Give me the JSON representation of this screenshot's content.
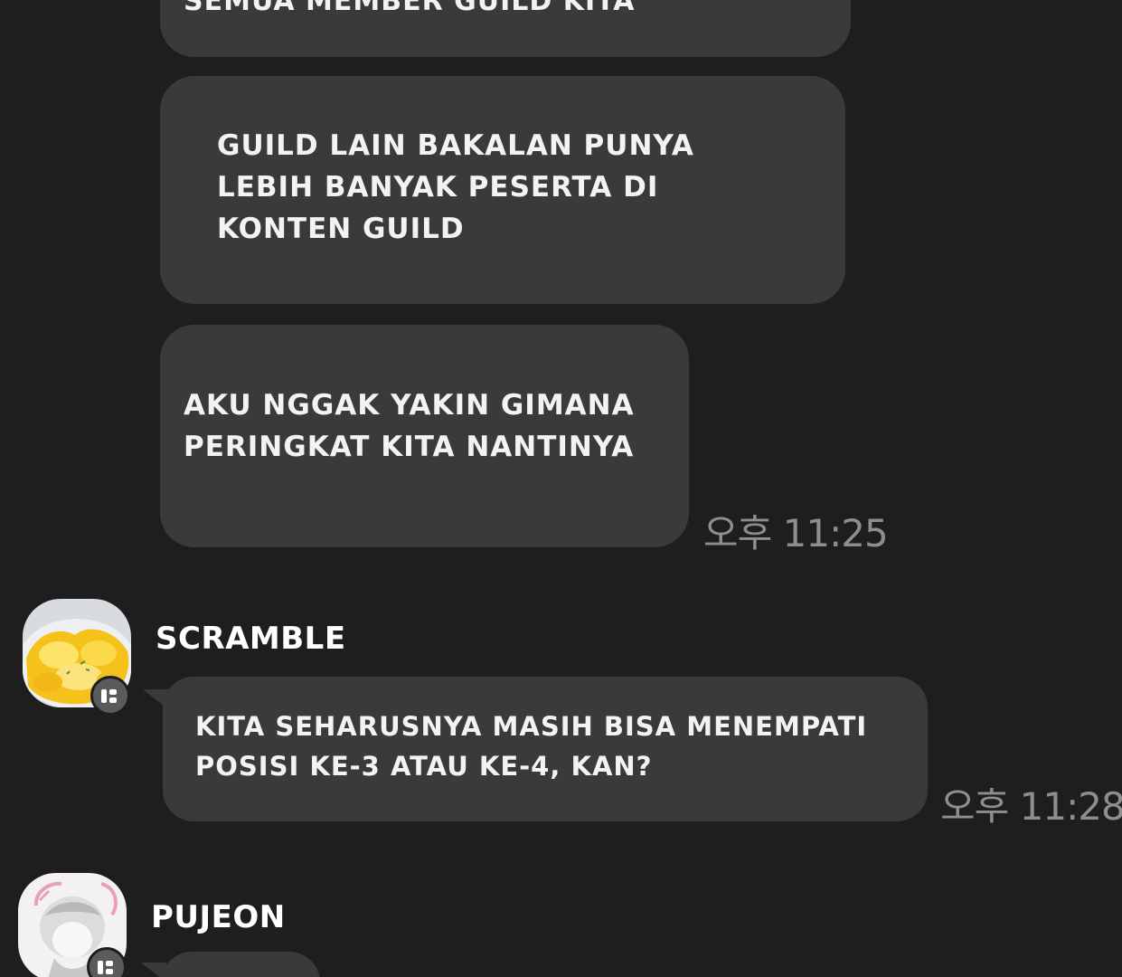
{
  "messages": [
    {
      "text": "SEMUA MEMBER GUILD KITA"
    },
    {
      "text": "GUILD LAIN BAKALAN PUNYA\nLEBIH BANYAK PESERTA DI\nKONTEN GUILD"
    },
    {
      "text": "AKU NGGAK YAKIN GIMANA\nPERINGKAT KITA NANTINYA",
      "time": "오후 11:25"
    },
    {
      "sender": "SCRAMBLE",
      "avatar_icon": "scrambled-eggs-avatar",
      "text": "KITA SEHARUSNYA MASIH BISA MENEMPATI\nPOSISI KE-3 ATAU KE-4, KAN?",
      "time": "오후 11:28"
    },
    {
      "sender": "PUJEON",
      "avatar_icon": "character-sketch-avatar"
    }
  ],
  "colors": {
    "background": "#1e1e1f",
    "bubble": "#3a3a3c",
    "text": "#f3f3f3",
    "timestamp": "#8e8e8e"
  }
}
